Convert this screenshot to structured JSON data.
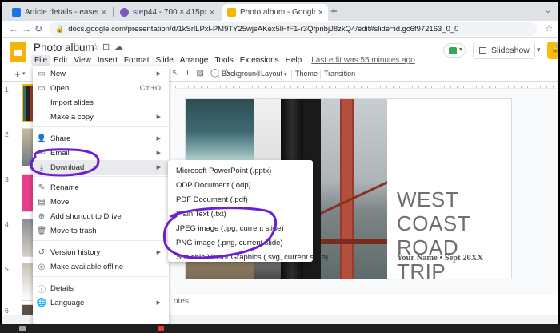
{
  "browser": {
    "tabs": [
      {
        "title": "Article details - easeus_webnews",
        "favicon_color": "#1a73e8",
        "active": false
      },
      {
        "title": "step44 - 700 × 415px",
        "favicon_color": "#7e57c2",
        "active": false
      },
      {
        "title": "Photo album - Google Slides",
        "favicon_color": "#f4b400",
        "active": true
      }
    ],
    "new_tab": "+",
    "url": "docs.google.com/presentation/d/1kSrlLPxl-PM9TY25wjsAKex5lHfF1-r3QfpnbjJ8zkQ4/edit#slide=id.gc6f972163_0_0"
  },
  "docs": {
    "title": "Photo album",
    "menus": [
      "File",
      "Edit",
      "View",
      "Insert",
      "Format",
      "Slide",
      "Arrange",
      "Tools",
      "Extensions",
      "Help"
    ],
    "last_edit": "Last edit was 55 minutes ago",
    "slideshow_label": "Slideshow",
    "share_icon": "lock-icon"
  },
  "toolbar": {
    "add": "+",
    "background": "Background",
    "layout": "Layout",
    "theme": "Theme",
    "transition": "Transition"
  },
  "filmstrip": {
    "numbers": [
      "1",
      "2",
      "3",
      "4",
      "5",
      "6"
    ]
  },
  "file_menu": {
    "items": [
      {
        "label": "New",
        "icon": "new-doc-icon",
        "arrow": true
      },
      {
        "label": "Open",
        "icon": "open-folder-icon",
        "shortcut": "Ctrl+O"
      },
      {
        "label": "Import slides",
        "icon": "",
        "arrow": false
      },
      {
        "label": "Make a copy",
        "icon": "copy-icon",
        "arrow": true
      },
      {
        "label": "Share",
        "icon": "share-person-icon",
        "arrow": true
      },
      {
        "label": "Email",
        "icon": "email-icon",
        "arrow": true
      },
      {
        "label": "Download",
        "icon": "download-icon",
        "arrow": true
      },
      {
        "label": "Rename",
        "icon": "rename-icon",
        "arrow": false
      },
      {
        "label": "Move",
        "icon": "move-icon",
        "arrow": false
      },
      {
        "label": "Add shortcut to Drive",
        "icon": "drive-shortcut-icon",
        "arrow": false
      },
      {
        "label": "Move to trash",
        "icon": "trash-icon",
        "arrow": false
      },
      {
        "label": "Version history",
        "icon": "history-icon",
        "arrow": true
      },
      {
        "label": "Make available offline",
        "icon": "offline-icon",
        "arrow": false
      },
      {
        "label": "Details",
        "icon": "info-icon",
        "arrow": false
      },
      {
        "label": "Language",
        "icon": "globe-icon",
        "arrow": true
      }
    ]
  },
  "download_menu": {
    "items": [
      "Microsoft PowerPoint (.pptx)",
      "ODP Document (.odp)",
      "PDF Document (.pdf)",
      "Plain Text (.txt)",
      "JPEG image (.jpg, current slide)",
      "PNG image (.png, current slide)",
      "Scalable Vector Graphics (.svg, current slide)"
    ]
  },
  "slide": {
    "title": "WEST COAST ROAD TRIP",
    "subtitle": "Your Name • Sept 20XX"
  },
  "notes_label": "otes",
  "colors": {
    "accent": "#f4b400",
    "annotation": "#6a1fd1",
    "highlight": "#e8eaed"
  }
}
